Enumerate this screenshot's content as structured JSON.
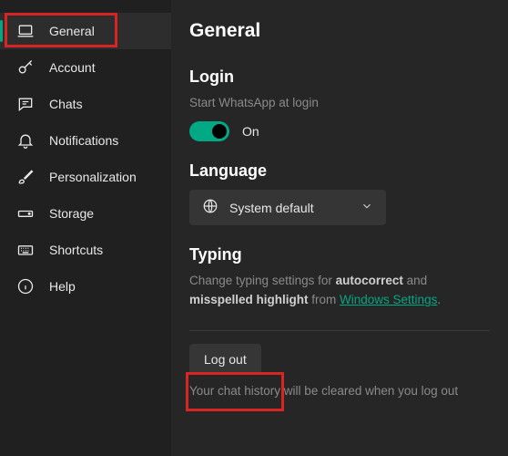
{
  "sidebar": {
    "items": [
      {
        "label": "General"
      },
      {
        "label": "Account"
      },
      {
        "label": "Chats"
      },
      {
        "label": "Notifications"
      },
      {
        "label": "Personalization"
      },
      {
        "label": "Storage"
      },
      {
        "label": "Shortcuts"
      },
      {
        "label": "Help"
      }
    ]
  },
  "main": {
    "title": "General",
    "login": {
      "heading": "Login",
      "description": "Start WhatsApp at login",
      "toggle_state": "On"
    },
    "language": {
      "heading": "Language",
      "selected": "System default"
    },
    "typing": {
      "heading": "Typing",
      "text_prefix": "Change typing settings for ",
      "bold1": "autocorrect",
      "mid": " and ",
      "bold2": "misspelled highlight",
      "text_from": " from ",
      "link_label": "Windows Settings",
      "period": "."
    },
    "logout": {
      "button": "Log out",
      "warning": "Your chat history will be cleared when you log out"
    }
  }
}
